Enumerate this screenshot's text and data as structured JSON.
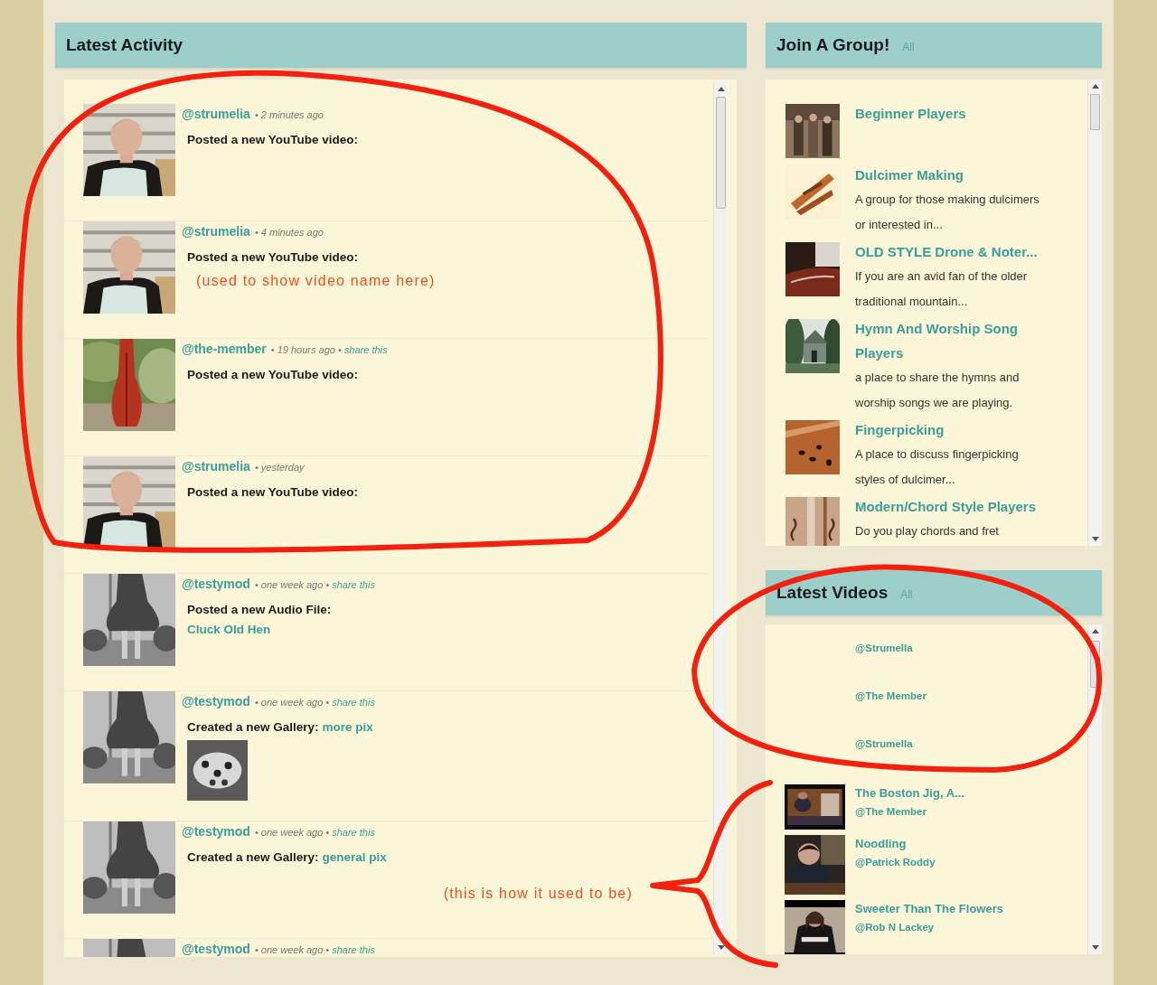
{
  "activity": {
    "title": "Latest Activity",
    "items": [
      {
        "user": "@strumelia",
        "time": "• 2 minutes ago",
        "action": "Posted a new YouTube video:"
      },
      {
        "user": "@strumelia",
        "time": "• 4 minutes ago",
        "action": "Posted a new YouTube video:",
        "note": "(used to show video name here)"
      },
      {
        "user": "@the-member",
        "time": "• 19 hours ago •",
        "share": "share this",
        "action": "Posted a new YouTube video:"
      },
      {
        "user": "@strumelia",
        "time": "• yesterday",
        "action": "Posted a new YouTube video:"
      },
      {
        "user": "@testymod",
        "time": "• one week ago •",
        "share": "share this",
        "action": "Posted a new Audio File:",
        "link_below": "Cluck Old Hen"
      },
      {
        "user": "@testymod",
        "time": "• one week ago •",
        "share": "share this",
        "action": "Created a new Gallery:",
        "link": "more pix"
      },
      {
        "user": "@testymod",
        "time": "• one week ago •",
        "share": "share this",
        "action": "Created a new Gallery:",
        "link": "general pix",
        "aside_note": "(this is how it used to be)"
      },
      {
        "user": "@testymod",
        "time": "• one week ago •",
        "share": "share this"
      }
    ]
  },
  "groups": {
    "title": "Join A Group!",
    "all_link": "All",
    "items": [
      {
        "name": "Beginner Players"
      },
      {
        "name": "Dulcimer Making",
        "description": "A group for those making dulcimers or interested in..."
      },
      {
        "name": "OLD STYLE Drone & Noter...",
        "description": "If you are an avid fan of the older traditional mountain..."
      },
      {
        "name": "Hymn And Worship Song Players",
        "description": "a place to share the hymns and worship songs we are playing."
      },
      {
        "name": "Fingerpicking",
        "description": "A place to discuss fingerpicking styles of dulcimer..."
      },
      {
        "name": "Modern/Chord Style Players",
        "description": "Do you play chords and fret"
      }
    ]
  },
  "videos": {
    "title": "Latest Videos",
    "all_link": "All",
    "items": [
      {
        "author": "@Strumella"
      },
      {
        "author": "@The Member"
      },
      {
        "author": "@Strumella"
      },
      {
        "title": "The Boston Jig, A...",
        "author": "@The Member"
      },
      {
        "title": "Noodling",
        "author": "@Patrick Roddy"
      },
      {
        "title": "Sweeter Than The Flowers",
        "author": "@Rob N Lackey"
      }
    ]
  }
}
